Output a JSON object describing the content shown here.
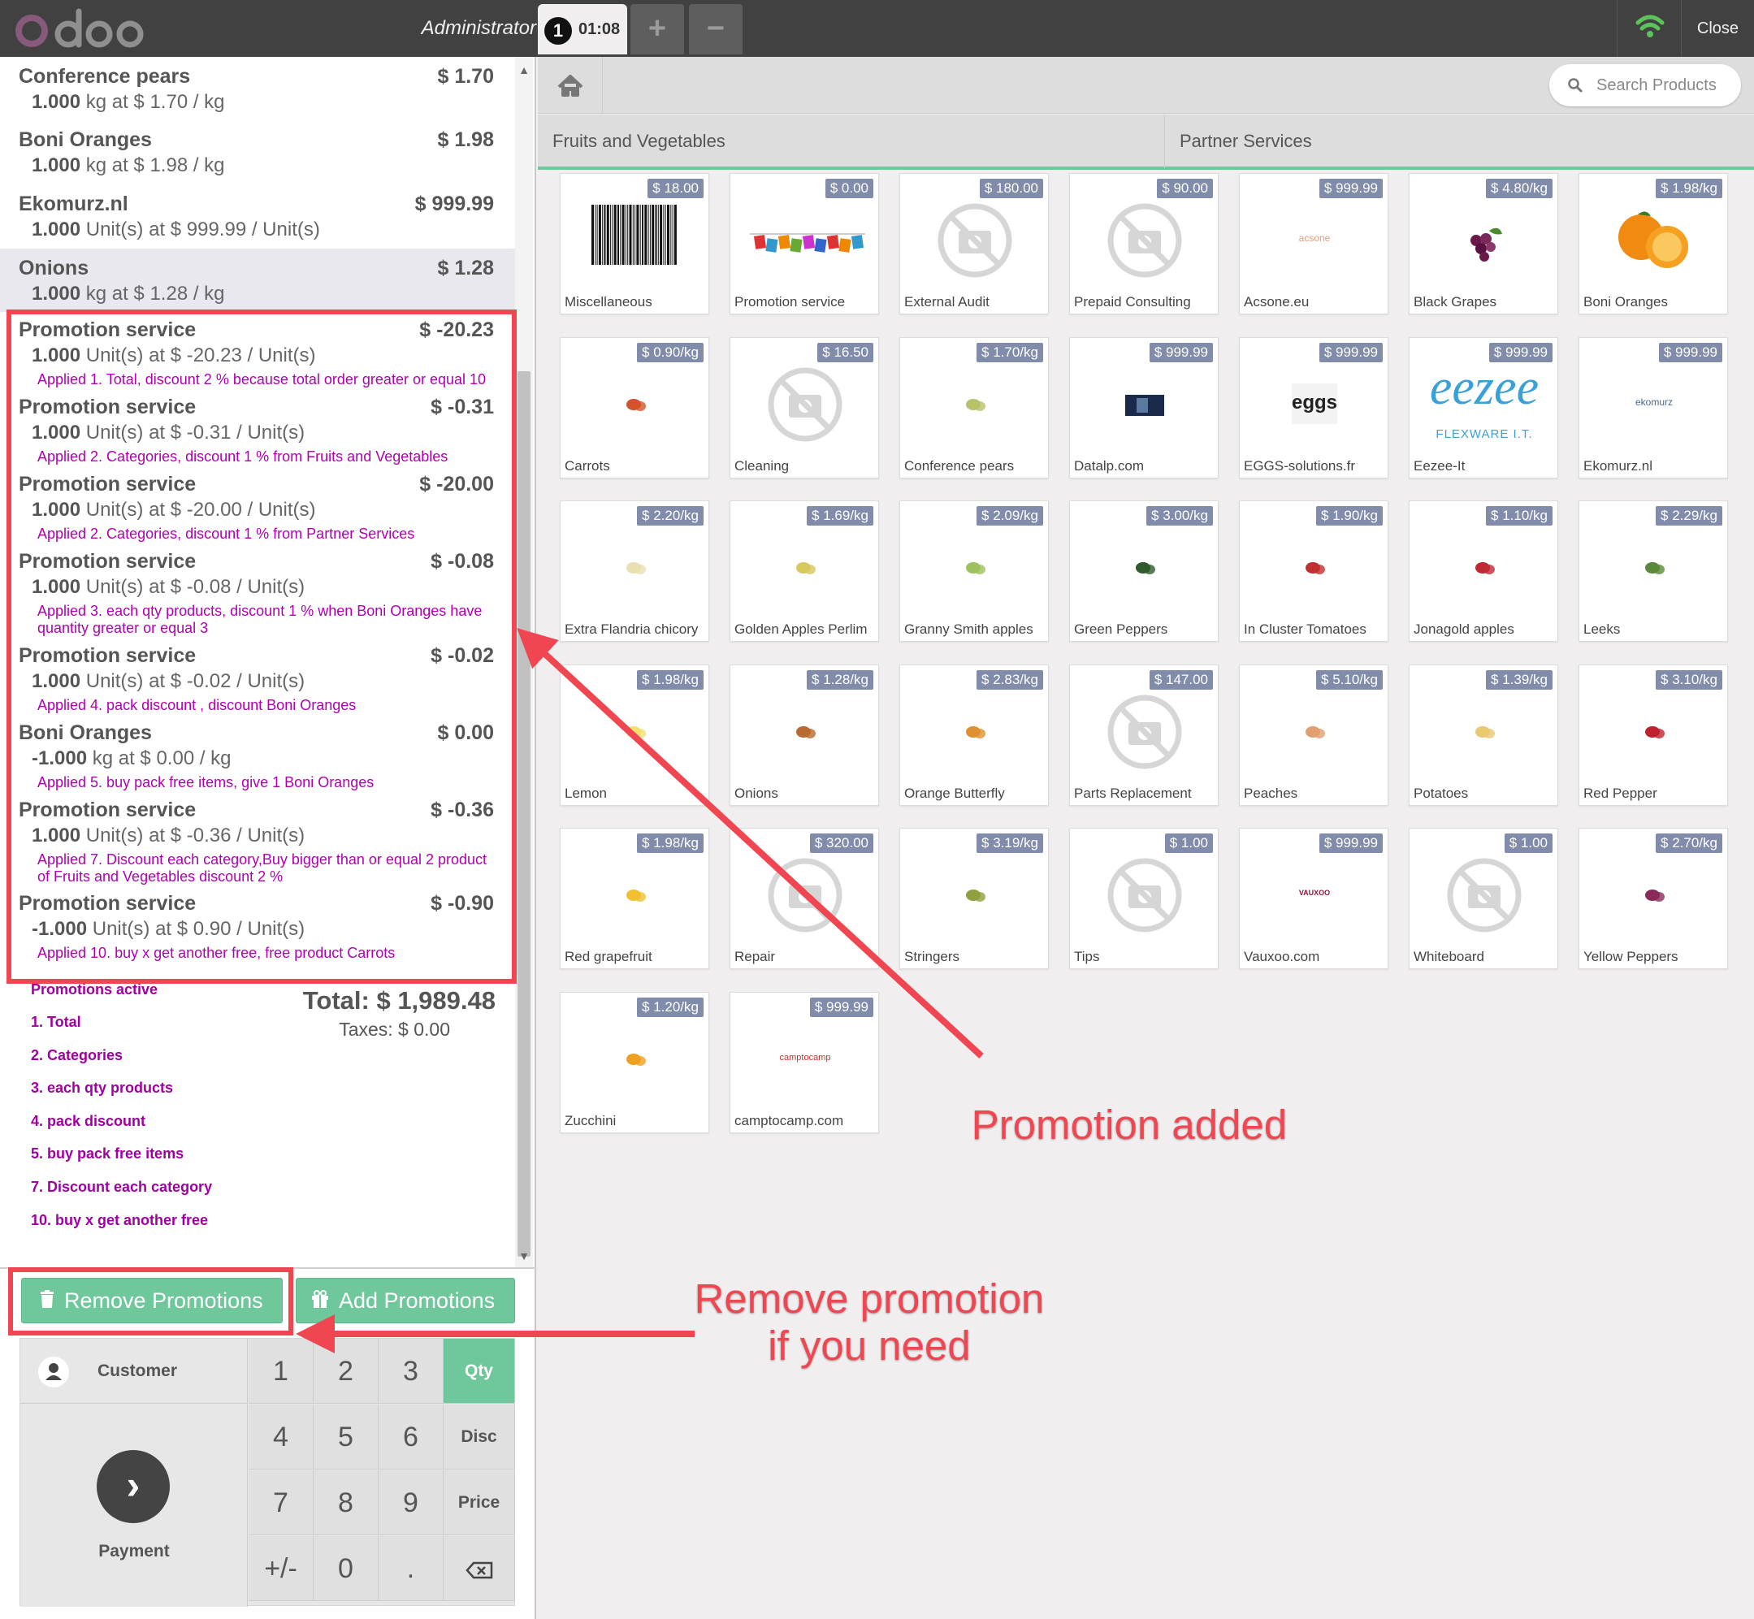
{
  "header": {
    "logo": "odoo",
    "user": "Administrator",
    "order_number": "1",
    "order_time": "01:08",
    "add_order": "+",
    "remove_order": "−",
    "close": "Close"
  },
  "order": {
    "lines": [
      {
        "name": "Conference pears",
        "price": "$ 1.70",
        "qty": "1.000",
        "unit_info": "kg at $ 1.70 / kg"
      },
      {
        "name": "Boni Oranges",
        "price": "$ 1.98",
        "qty": "1.000",
        "unit_info": "kg at $ 1.98 / kg"
      },
      {
        "name": "Ekomurz.nl",
        "price": "$ 999.99",
        "qty": "1.000",
        "unit_info": "Unit(s) at $ 999.99 / Unit(s)"
      },
      {
        "name": "Onions",
        "price": "$ 1.28",
        "qty": "1.000",
        "unit_info": "kg at $ 1.28 / kg",
        "selected": true
      },
      {
        "name": "Promotion service",
        "price": "$ -20.23",
        "qty": "1.000",
        "unit_info": "Unit(s) at $ -20.23 / Unit(s)",
        "applied": "Applied 1. Total, discount 2 % because total order greater or equal 10"
      },
      {
        "name": "Promotion service",
        "price": "$ -0.31",
        "qty": "1.000",
        "unit_info": "Unit(s) at $ -0.31 / Unit(s)",
        "applied": "Applied 2. Categories, discount 1 % from Fruits and Vegetables"
      },
      {
        "name": "Promotion service",
        "price": "$ -20.00",
        "qty": "1.000",
        "unit_info": "Unit(s) at $ -20.00 / Unit(s)",
        "applied": "Applied 2. Categories, discount 1 % from Partner Services"
      },
      {
        "name": "Promotion service",
        "price": "$ -0.08",
        "qty": "1.000",
        "unit_info": "Unit(s) at $ -0.08 / Unit(s)",
        "applied": "Applied 3. each qty products, discount 1 % when Boni Oranges have quantity greater or equal 3"
      },
      {
        "name": "Promotion service",
        "price": "$ -0.02",
        "qty": "1.000",
        "unit_info": "Unit(s) at $ -0.02 / Unit(s)",
        "applied": "Applied 4. pack discount , discount Boni Oranges"
      },
      {
        "name": "Boni Oranges",
        "price": "$ 0.00",
        "qty": "-1.000",
        "unit_info": "kg at $ 0.00 / kg",
        "applied": "Applied 5. buy pack free items, give 1 Boni Oranges"
      },
      {
        "name": "Promotion service",
        "price": "$ -0.36",
        "qty": "1.000",
        "unit_info": "Unit(s) at $ -0.36 / Unit(s)",
        "applied": "Applied 7. Discount each category,Buy bigger than or equal 2 product of Fruits and Vegetables discount 2 %"
      },
      {
        "name": "Promotion service",
        "price": "$ -0.90",
        "qty": "-1.000",
        "unit_info": "Unit(s) at $ 0.90 / Unit(s)",
        "applied": "Applied 10. buy x get another free, free product Carrots"
      }
    ],
    "promotions_title": "Promotions active",
    "promotions": [
      "1. Total",
      "2. Categories",
      "3. each qty products",
      "4. pack discount",
      "5. buy pack free items",
      "7. Discount each category",
      "10. buy x get another free"
    ],
    "total": "Total: $ 1,989.48",
    "taxes": "Taxes: $ 0.00"
  },
  "actions": {
    "remove_promotions": "Remove Promotions",
    "add_promotions": "Add Promotions"
  },
  "numpad": {
    "customer": "Customer",
    "payment": "Payment",
    "keys": [
      "1",
      "2",
      "3",
      "Qty",
      "4",
      "5",
      "6",
      "Disc",
      "7",
      "8",
      "9",
      "Price",
      "+/-",
      "0",
      "."
    ],
    "active_mode": "Qty"
  },
  "products_screen": {
    "search_placeholder": "Search Products",
    "categories": [
      "Fruits and Vegetables",
      "Partner Services"
    ],
    "products": [
      {
        "name": "Miscellaneous",
        "price": "$ 18.00",
        "image": "barcode"
      },
      {
        "name": "Promotion service",
        "price": "$ 0.00",
        "image": "promotion-banner"
      },
      {
        "name": "External Audit",
        "price": "$ 180.00",
        "image": "no-image"
      },
      {
        "name": "Prepaid Consulting",
        "price": "$ 90.00",
        "image": "no-image"
      },
      {
        "name": "Acsone.eu",
        "price": "$ 999.99",
        "image": "logo",
        "logo_text": "acsone"
      },
      {
        "name": "Black Grapes",
        "price": "$ 4.80/kg",
        "image": "fruit"
      },
      {
        "name": "Boni Oranges",
        "price": "$ 1.98/kg",
        "image": "oranges"
      },
      {
        "name": "Carrots",
        "price": "$ 0.90/kg",
        "image": "fruit"
      },
      {
        "name": "Cleaning",
        "price": "$ 16.50",
        "image": "no-image"
      },
      {
        "name": "Conference pears",
        "price": "$ 1.70/kg",
        "image": "fruit"
      },
      {
        "name": "Datalp.com",
        "price": "$ 999.99",
        "image": "photo"
      },
      {
        "name": "EGGS-solutions.fr",
        "price": "$ 999.99",
        "image": "logo",
        "logo_text": "eggs"
      },
      {
        "name": "Eezee-It",
        "price": "$ 999.99",
        "image": "logo",
        "logo_text": "eezee",
        "logo_sub": "FLEXWARE I.T."
      },
      {
        "name": "Ekomurz.nl",
        "price": "$ 999.99",
        "image": "logo",
        "logo_text": "ekomurz"
      },
      {
        "name": "Extra Flandria chicory",
        "price": "$ 2.20/kg",
        "image": "fruit"
      },
      {
        "name": "Golden Apples Perlim",
        "price": "$ 1.69/kg",
        "image": "fruit"
      },
      {
        "name": "Granny Smith apples",
        "price": "$ 2.09/kg",
        "image": "fruit"
      },
      {
        "name": "Green Peppers",
        "price": "$ 3.00/kg",
        "image": "fruit"
      },
      {
        "name": "In Cluster Tomatoes",
        "price": "$ 1.90/kg",
        "image": "fruit"
      },
      {
        "name": "Jonagold apples",
        "price": "$ 1.10/kg",
        "image": "fruit"
      },
      {
        "name": "Leeks",
        "price": "$ 2.29/kg",
        "image": "fruit"
      },
      {
        "name": "Lemon",
        "price": "$ 1.98/kg",
        "image": "fruit"
      },
      {
        "name": "Onions",
        "price": "$ 1.28/kg",
        "image": "fruit"
      },
      {
        "name": "Orange Butterfly",
        "price": "$ 2.83/kg",
        "image": "fruit"
      },
      {
        "name": "Parts Replacement",
        "price": "$ 147.00",
        "image": "no-image"
      },
      {
        "name": "Peaches",
        "price": "$ 5.10/kg",
        "image": "fruit"
      },
      {
        "name": "Potatoes",
        "price": "$ 1.39/kg",
        "image": "fruit"
      },
      {
        "name": "Red Pepper",
        "price": "$ 3.10/kg",
        "image": "fruit"
      },
      {
        "name": "Red grapefruit",
        "price": "$ 1.98/kg",
        "image": "fruit"
      },
      {
        "name": "Repair",
        "price": "$ 320.00",
        "image": "no-image"
      },
      {
        "name": "Stringers",
        "price": "$ 3.19/kg",
        "image": "fruit"
      },
      {
        "name": "Tips",
        "price": "$ 1.00",
        "image": "no-image"
      },
      {
        "name": "Vauxoo.com",
        "price": "$ 999.99",
        "image": "logo",
        "logo_text": "VAUXOO"
      },
      {
        "name": "Whiteboard",
        "price": "$ 1.00",
        "image": "no-image"
      },
      {
        "name": "Yellow Peppers",
        "price": "$ 2.70/kg",
        "image": "fruit"
      },
      {
        "name": "Zucchini",
        "price": "$ 1.20/kg",
        "image": "fruit"
      },
      {
        "name": "camptocamp.com",
        "price": "$ 999.99",
        "image": "logo",
        "logo_text": "camptocamp"
      }
    ]
  },
  "annotations": {
    "promotion_added": "Promotion added",
    "remove_promotion_line1": "Remove promotion",
    "remove_promotion_line2": "if you need"
  },
  "colors": {
    "header_bg": "#414141",
    "accent_green": "#6ec89b",
    "promo_text": "#a000a0",
    "annotation_red": "#f04651",
    "price_tag": "#7380a0",
    "logo_purple": "#875a7b"
  }
}
